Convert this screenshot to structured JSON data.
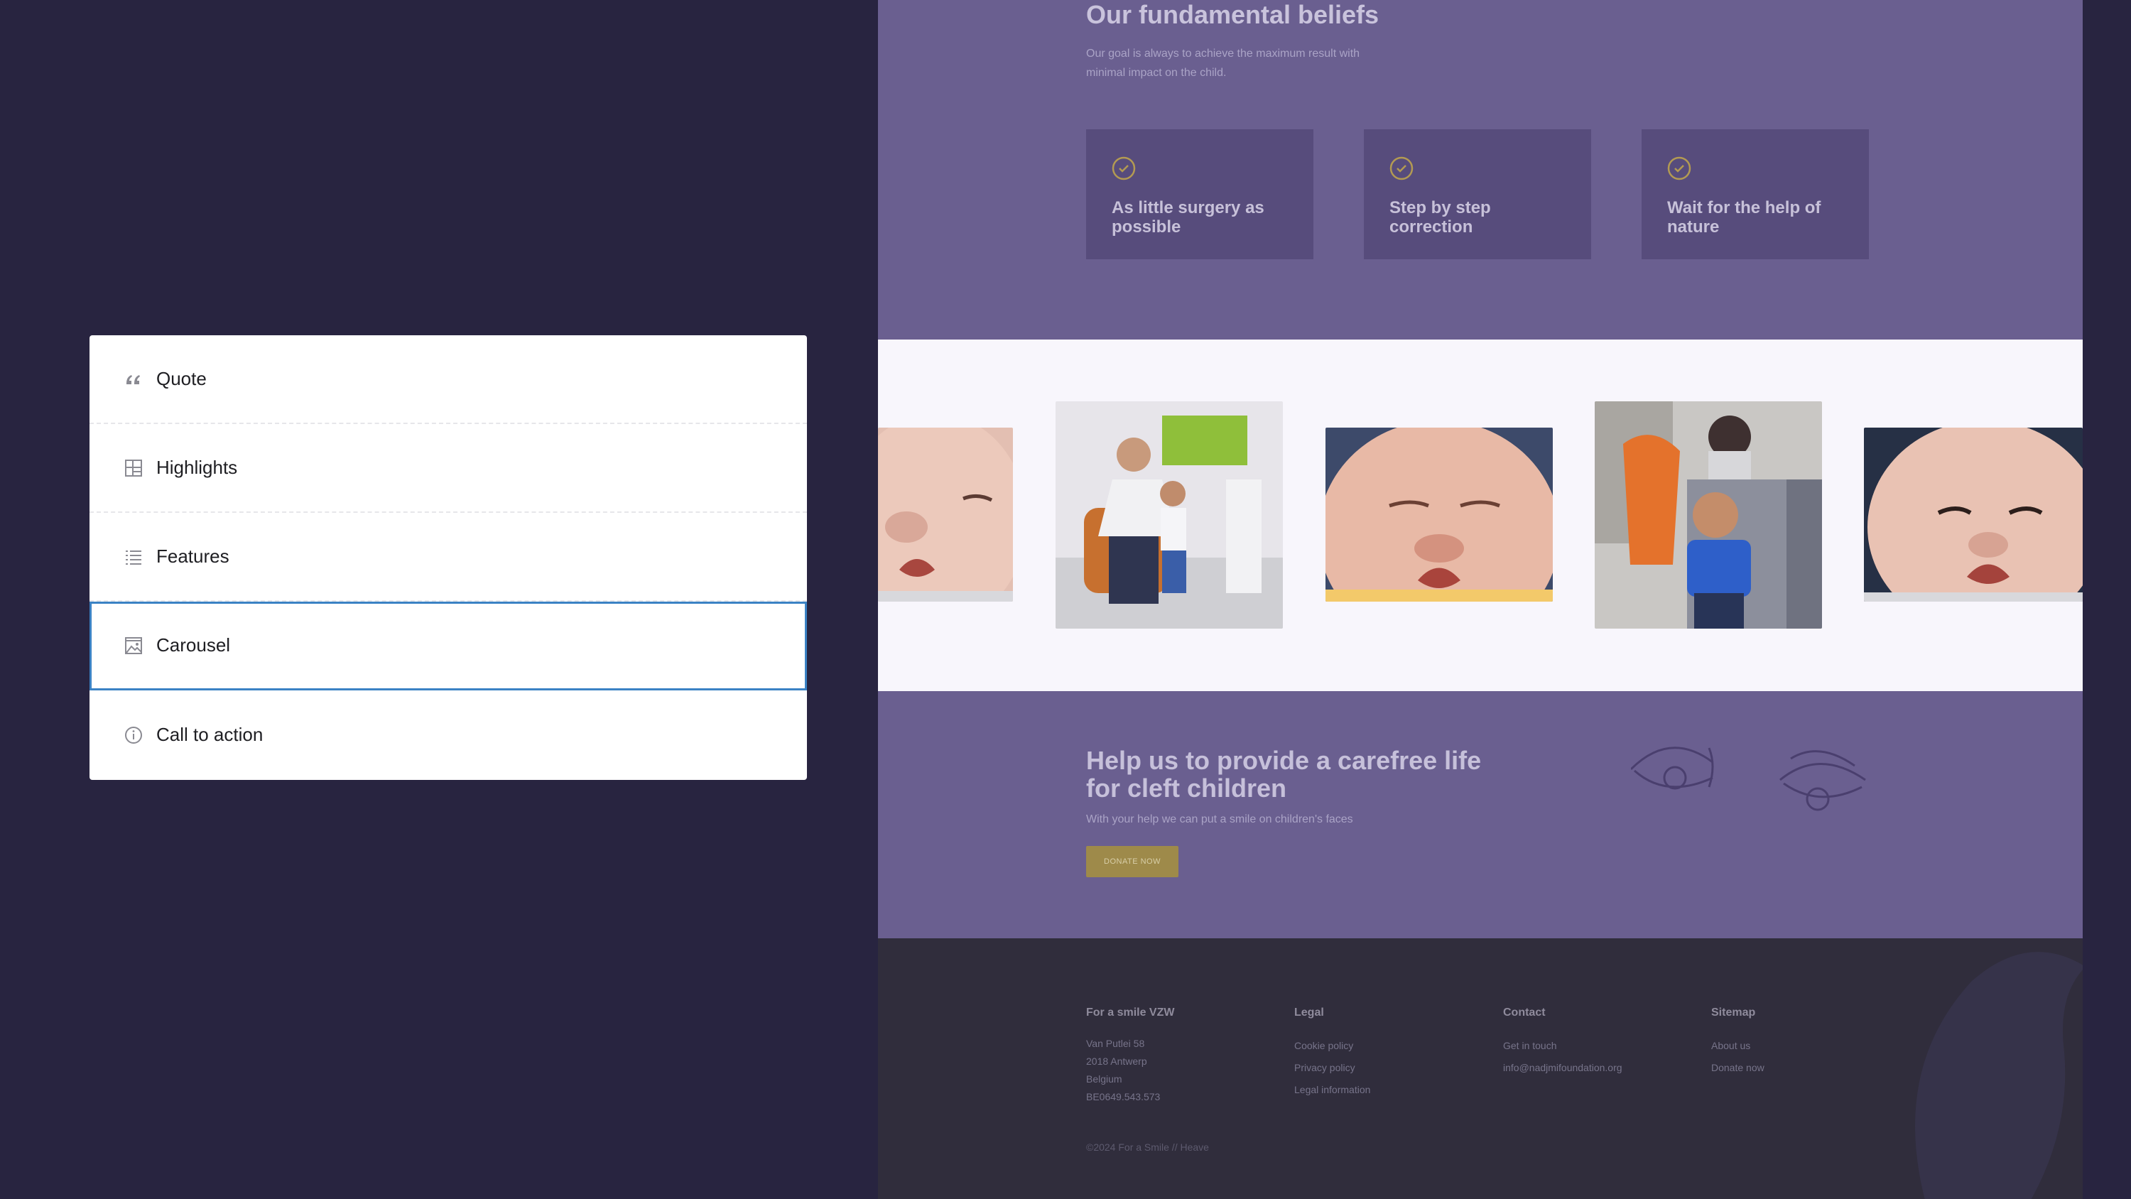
{
  "block_menu": {
    "items": [
      {
        "label": "Quote",
        "icon": "quote-icon"
      },
      {
        "label": "Highlights",
        "icon": "highlights-grid-icon"
      },
      {
        "label": "Features",
        "icon": "list-icon"
      },
      {
        "label": "Carousel",
        "icon": "image-icon",
        "selected": true
      },
      {
        "label": "Call to action",
        "icon": "info-icon"
      }
    ],
    "selected_color": "#3b82c4"
  },
  "preview": {
    "beliefs": {
      "title": "Our fundamental beliefs",
      "subtitle": "Our goal is always to achieve the maximum result with minimal impact on the child.",
      "cards": [
        {
          "label": "As little surgery as possible",
          "icon": "check-circle-icon"
        },
        {
          "label": "Step by step correction",
          "icon": "check-circle-icon"
        },
        {
          "label": "Wait for the help of nature",
          "icon": "check-circle-icon"
        }
      ]
    },
    "carousel": {
      "photos": [
        {
          "name": "baby-cleft-lip-photo"
        },
        {
          "name": "doctor-with-boy-photo"
        },
        {
          "name": "sleeping-baby-cleft-lip-photo"
        },
        {
          "name": "boy-in-clinic-photo"
        },
        {
          "name": "baby-cleft-lip-photo-2"
        }
      ]
    },
    "cta": {
      "title": "Help us to provide a carefree life for cleft children",
      "subtitle": "With your help we can put a smile on children's faces",
      "button": "DONATE NOW"
    },
    "footer": {
      "org": {
        "heading": "For a smile VZW",
        "lines": [
          "Van Putlei 58",
          "2018 Antwerp",
          "Belgium",
          "BE0649.543.573"
        ]
      },
      "legal": {
        "heading": "Legal",
        "links": [
          "Cookie policy",
          "Privacy policy",
          "Legal information"
        ]
      },
      "contact": {
        "heading": "Contact",
        "links": [
          "Get in touch",
          "info@nadjmifoundation.org"
        ]
      },
      "sitemap": {
        "heading": "Sitemap",
        "links": [
          "About us",
          "Donate now"
        ]
      },
      "copyright": "©2024 For a Smile // Heave"
    }
  },
  "colors": {
    "page_bg": "#282440",
    "preview_purple": "#6a5f90",
    "card_purple": "#574c7c",
    "accent_gold": "#9e8a4a",
    "footer_bg": "#302d3c"
  }
}
